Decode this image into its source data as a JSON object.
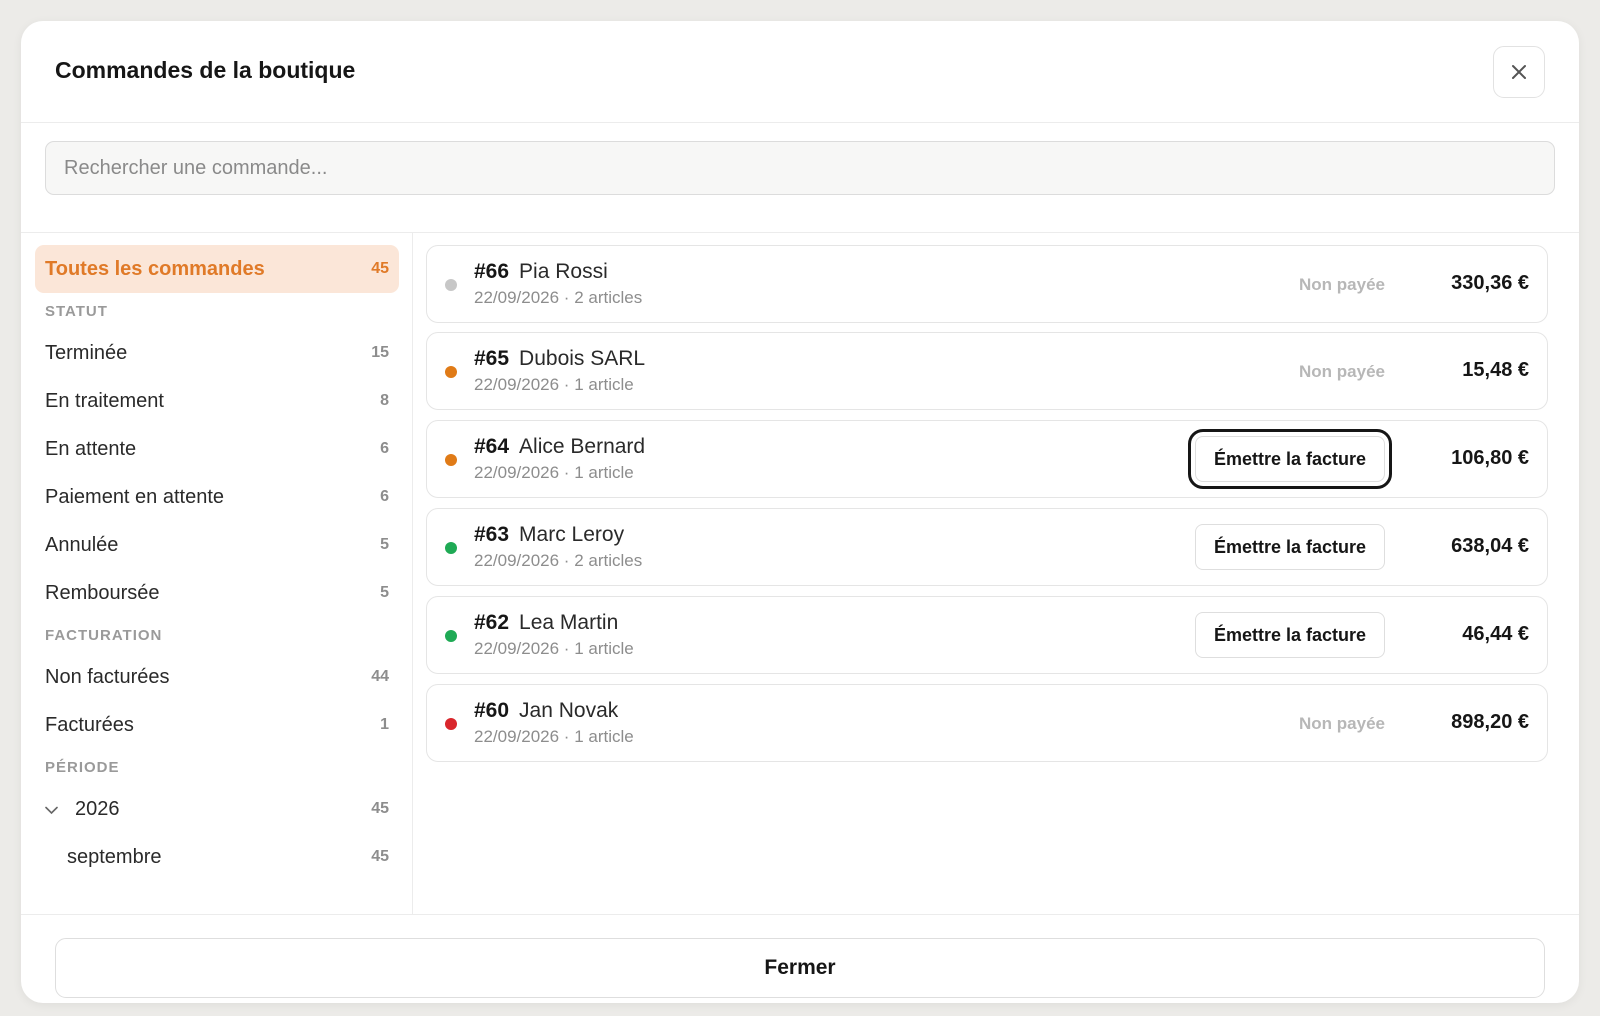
{
  "modal": {
    "title": "Commandes de la boutique",
    "close_icon": "close-icon"
  },
  "search": {
    "placeholder": "Rechercher une commande...",
    "value": ""
  },
  "sidebar": {
    "all": {
      "label": "Toutes les commandes",
      "count": "45"
    },
    "sections": {
      "status": "STATUT",
      "billing": "FACTURATION",
      "period": "PÉRIODE"
    },
    "status_items": [
      {
        "label": "Terminée",
        "count": "15"
      },
      {
        "label": "En traitement",
        "count": "8"
      },
      {
        "label": "En attente",
        "count": "6"
      },
      {
        "label": "Paiement en attente",
        "count": "6"
      },
      {
        "label": "Annulée",
        "count": "5"
      },
      {
        "label": "Remboursée",
        "count": "5"
      }
    ],
    "billing_items": [
      {
        "label": "Non facturées",
        "count": "44"
      },
      {
        "label": "Facturées",
        "count": "1"
      }
    ],
    "period_items": [
      {
        "label": "2026",
        "count": "45",
        "icon": "chevron-down-icon"
      },
      {
        "label": "septembre",
        "count": "45"
      }
    ]
  },
  "colors": {
    "accent": "#e07a28",
    "status_grey": "#c7c7c7",
    "status_orange": "#e07b17",
    "status_green": "#1faa55",
    "status_red": "#d9262c"
  },
  "orders": [
    {
      "number": "#66",
      "customer": "Pia Rossi",
      "meta": "22/09/2026 · 2 articles",
      "status": "Non payée",
      "action": "",
      "amount": "330,36 €",
      "dot": "#c7c7c7"
    },
    {
      "number": "#65",
      "customer": "Dubois SARL",
      "meta": "22/09/2026 · 1 article",
      "status": "Non payée",
      "action": "",
      "amount": "15,48 €",
      "dot": "#e07b17"
    },
    {
      "number": "#64",
      "customer": "Alice Bernard",
      "meta": "22/09/2026 · 1 article",
      "status": "",
      "action": "Émettre la facture",
      "amount": "106,80 €",
      "dot": "#e07b17"
    },
    {
      "number": "#63",
      "customer": "Marc Leroy",
      "meta": "22/09/2026 · 2 articles",
      "status": "",
      "action": "Émettre la facture",
      "amount": "638,04 €",
      "dot": "#1faa55"
    },
    {
      "number": "#62",
      "customer": "Lea Martin",
      "meta": "22/09/2026 · 1 article",
      "status": "",
      "action": "Émettre la facture",
      "amount": "46,44 €",
      "dot": "#1faa55"
    },
    {
      "number": "#60",
      "customer": "Jan Novak",
      "meta": "22/09/2026 · 1 article",
      "status": "Non payée",
      "action": "",
      "amount": "898,20 €",
      "dot": "#d9262c"
    }
  ],
  "footer": {
    "close_label": "Fermer"
  }
}
